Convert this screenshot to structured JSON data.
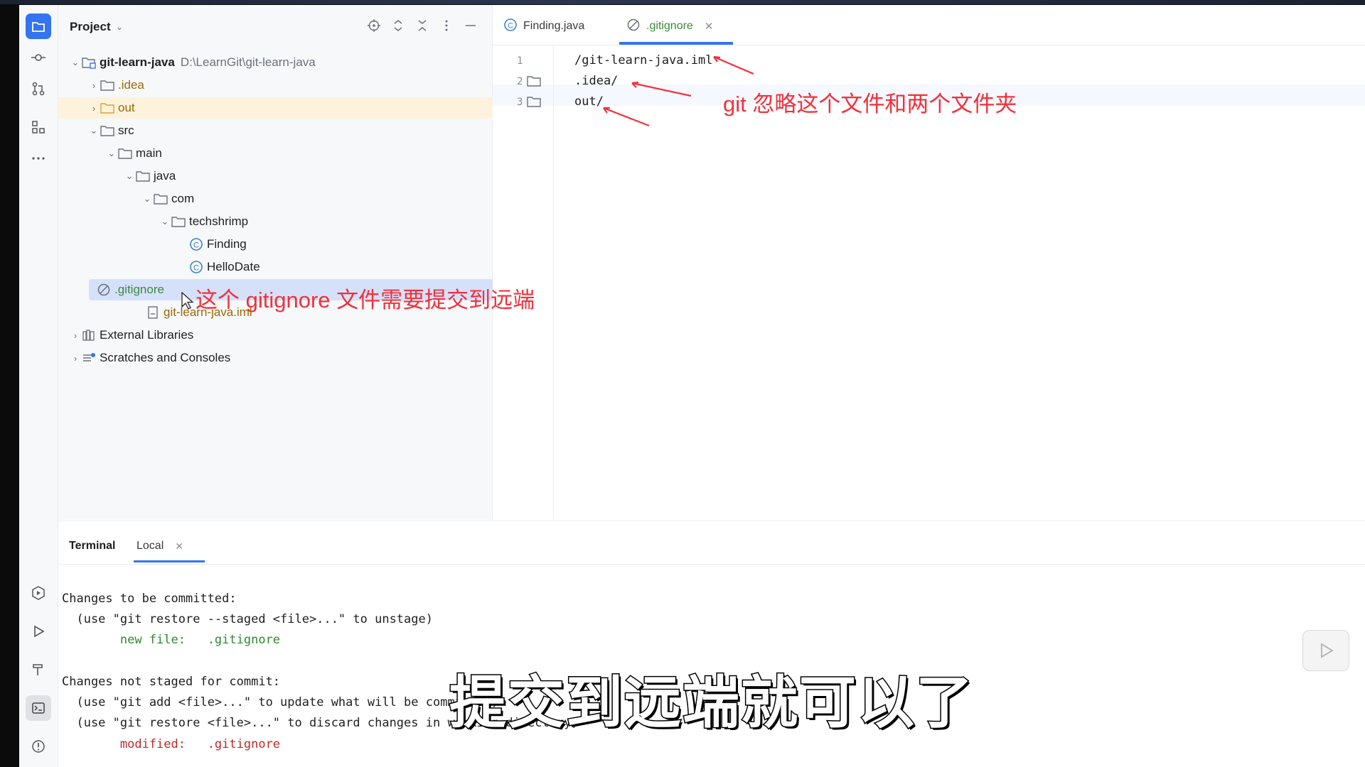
{
  "project_panel": {
    "title": "Project",
    "header_icons": [
      "locate-icon",
      "expand-all-icon",
      "collapse-all-icon",
      "more-icon",
      "minimize-icon"
    ]
  },
  "tree": [
    {
      "label": "git-learn-java",
      "path": "D:\\LearnGit\\git-learn-java",
      "icon": "module-folder-icon"
    },
    {
      "label": ".idea",
      "icon": "folder-icon"
    },
    {
      "label": "out",
      "icon": "folder-icon"
    },
    {
      "label": "src",
      "icon": "folder-icon"
    },
    {
      "label": "main",
      "icon": "folder-icon"
    },
    {
      "label": "java",
      "icon": "folder-icon"
    },
    {
      "label": "com",
      "icon": "folder-icon"
    },
    {
      "label": "techshrimp",
      "icon": "package-icon"
    },
    {
      "label": "Finding",
      "icon": "java-class-icon"
    },
    {
      "label": "HelloDate",
      "icon": "java-class-icon"
    },
    {
      "label": ".gitignore",
      "icon": "ignore-file-icon"
    },
    {
      "label": "git-learn-java.iml",
      "icon": "iml-file-icon"
    },
    {
      "label": "External Libraries",
      "icon": "library-icon"
    },
    {
      "label": "Scratches and Consoles",
      "icon": "scratches-icon"
    }
  ],
  "editor": {
    "tabs": [
      {
        "label": "Finding.java",
        "icon": "java-class-icon"
      },
      {
        "label": ".gitignore",
        "icon": "ignore-file-icon",
        "active": true
      }
    ],
    "line_numbers": [
      "1",
      "2",
      "3"
    ],
    "lines": [
      "/git-learn-java.iml",
      ".idea/",
      "out/"
    ]
  },
  "terminal": {
    "title": "Terminal",
    "tab": "Local",
    "lines": [
      "Changes to be committed:",
      "  (use \"git restore --staged <file>...\" to unstage)",
      "        new file:   .gitignore",
      "",
      "Changes not staged for commit:",
      "  (use \"git add <file>...\" to update what will be committed)",
      "  (use \"git restore <file>...\" to discard changes in working directory)",
      "        modified:   .gitignore"
    ]
  },
  "annotations": {
    "editor_note": "git 忽略这个文件和两个文件夹",
    "tree_note": "这个 gitignore 文件需要提交到远端",
    "subtitle": "提交到远端就可以了"
  },
  "colors": {
    "accent": "#3574f0",
    "annotation_red": "#f2303a",
    "git_added_green": "#3b8b3b",
    "git_modified_red": "#c02828",
    "excluded_brown": "#9a6a00"
  }
}
